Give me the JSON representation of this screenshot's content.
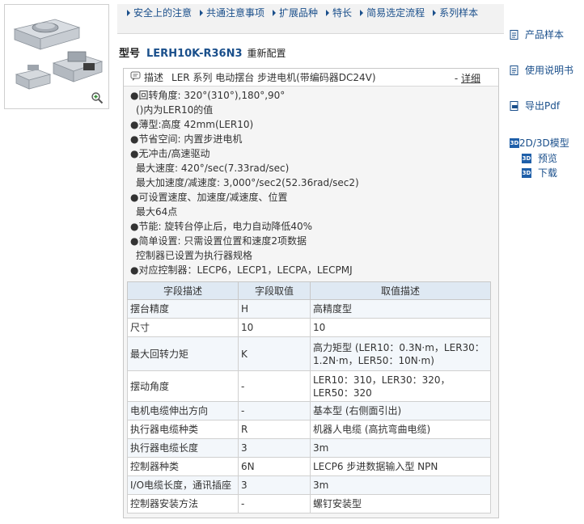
{
  "top_nav": {
    "items": [
      "安全上的注意",
      "共通注意事项",
      "扩展品种",
      "特长",
      "简易选定流程",
      "系列样本"
    ]
  },
  "model": {
    "label": "型号",
    "number": "LERH10K-R36N3",
    "reconfigure": "重新配置"
  },
  "description": {
    "label": "描述",
    "text": "LER 系列 电动摆台 步进电机(带编码器DC24V)",
    "detail_link": "详细",
    "detail_prefix": "- "
  },
  "features": [
    "●回转角度: 320°(310°),180°,90°",
    "()内为LER10的值",
    "●薄型:高度 42mm(LER10)",
    "●节省空间: 内置步进电机",
    "●无冲击/高速驱动",
    "最大速度: 420°/sec(7.33rad/sec)",
    "最大加速度/减速度: 3,000°/sec2(52.36rad/sec2)",
    "●可设置速度、加速度/减速度、位置",
    "最大64点",
    "●节能: 旋转台停止后，电力自动降低40%",
    "●简单设置: 只需设置位置和速度2项数据",
    "控制器已设置为执行器规格",
    "●对应控制器：LECP6，LECP1，LECPA，LECPMJ"
  ],
  "spec_table": {
    "headers": [
      "字段描述",
      "字段取值",
      "取值描述"
    ],
    "rows": [
      [
        "摆台精度",
        "H",
        "高精度型"
      ],
      [
        "尺寸",
        "10",
        "10"
      ],
      [
        "最大回转力矩",
        "K",
        "高力矩型 (LER10：0.3N·m，LER30：1.2N·m，LER50：10N·m)"
      ],
      [
        "摆动角度",
        "-",
        "LER10：310，LER30：320，LER50：320"
      ],
      [
        "电机电缆伸出方向",
        "-",
        "基本型 (右侧面引出)"
      ],
      [
        "执行器电缆种类",
        "R",
        "机器人电缆 (高抗弯曲电缆)"
      ],
      [
        "执行器电缆长度",
        "3",
        "3m"
      ],
      [
        "控制器种类",
        "6N",
        "LECP6 步进数据输入型 NPN"
      ],
      [
        "I/O电缆长度，通讯插座",
        "3",
        "3m"
      ],
      [
        "控制器安装方法",
        "-",
        "螺钉安装型"
      ]
    ]
  },
  "sidebar": {
    "catalog": "产品样本",
    "manual": "使用说明书",
    "pdf": "导出Pdf",
    "models_3d": "2D/3D模型",
    "preview": "预览",
    "download": "下载",
    "badge_3d": "3D"
  }
}
